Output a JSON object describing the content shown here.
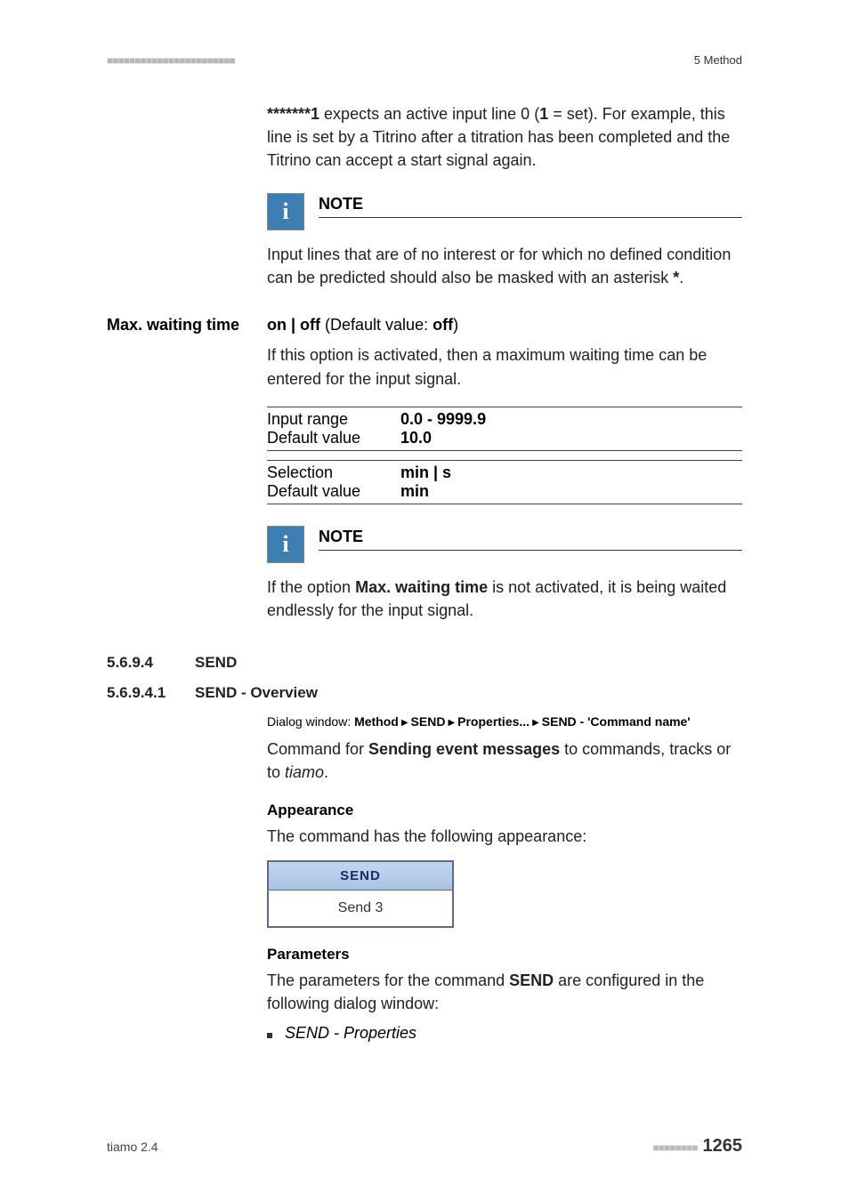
{
  "header": {
    "dots": "■■■■■■■■■■■■■■■■■■■■■■■",
    "chapter": "5 Method"
  },
  "intro": {
    "code": "*******1",
    "text1": " expects an active input line 0 (",
    "bold1": "1",
    "text2": " = set). For example, this line is set by a Titrino after a titration has been completed and the Titrino can accept a start signal again."
  },
  "note1": {
    "title": "NOTE",
    "body1": "Input lines that are of no interest or for which no defined condition can be predicted should also be masked with an asterisk ",
    "asterisk": "*",
    "body2": "."
  },
  "maxwait": {
    "side_label": "Max. waiting time",
    "opt_bold": "on | off",
    "opt_plain": " (Default value: ",
    "opt_default": "off",
    "opt_close": ")",
    "desc": "If this option is activated, then a maximum waiting time can be entered for the input signal.",
    "rows": [
      {
        "label": "Input range",
        "value": "0.0 - 9999.9"
      },
      {
        "label": "Default value",
        "value": "10.0"
      }
    ],
    "rows2": [
      {
        "label": "Selection",
        "value": "min | s"
      },
      {
        "label": "Default value",
        "value": "min"
      }
    ]
  },
  "note2": {
    "title": "NOTE",
    "pre": "If the option ",
    "bold": "Max. waiting time",
    "post": " is not activated, it is being waited endlessly for the input signal."
  },
  "sec1": {
    "num": "5.6.9.4",
    "title": "SEND"
  },
  "sec2": {
    "num": "5.6.9.4.1",
    "title": "SEND - Overview"
  },
  "breadcrumb": {
    "pre": "Dialog window: ",
    "p1": "Method",
    "p2": "SEND",
    "p3": "Properties...",
    "p4": "SEND - 'Command name'"
  },
  "cmd_desc": {
    "pre": "Command for ",
    "bold": "Sending event messages",
    "post": " to commands, tracks or to ",
    "italic": "tiamo",
    "end": "."
  },
  "appearance": {
    "heading": "Appearance",
    "desc": "The command has the following appearance:",
    "box_head": "SEND",
    "box_body": "Send 3"
  },
  "params": {
    "heading": "Parameters",
    "pre": "The parameters for the command ",
    "bold": "SEND",
    "post": " are configured in the following dialog window:",
    "bullet": "SEND - Properties"
  },
  "footer": {
    "left": "tiamo 2.4",
    "dots": "■■■■■■■■",
    "page": "1265"
  }
}
